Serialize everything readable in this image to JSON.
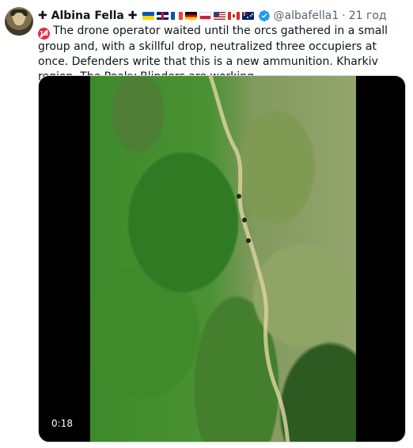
{
  "tweet": {
    "author_name": "✚ Albina Fella ✚",
    "flags": [
      "flag-ukraine-icon",
      "flag-uk-icon",
      "flag-france-icon",
      "flag-germany-icon",
      "flag-poland-icon",
      "flag-usa-icon",
      "flag-canada-icon",
      "flag-australia-icon"
    ],
    "verified": true,
    "handle": "@albafella1",
    "separator": "·",
    "time": "21 год",
    "text_emoji": "18",
    "text": "The drone operator waited until the orcs gathered in a small group and, with a skillful drop, neutralized three occupiers at once. Defenders write that this is a new ammunition. Kharkiv region. The Peaky Blinders are working.",
    "video": {
      "duration": "0:18"
    }
  },
  "colors": {
    "verified_badge": "#1d9bf0",
    "secondary_text": "#536471",
    "primary_text": "#0f1419"
  }
}
